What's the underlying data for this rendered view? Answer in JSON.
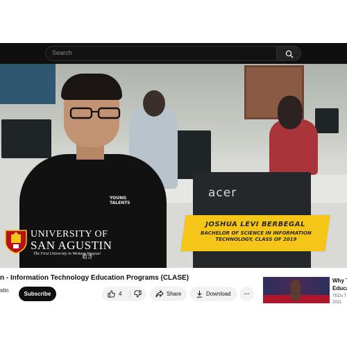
{
  "header": {
    "search_placeholder": "Search",
    "search_icon": "search-icon"
  },
  "video": {
    "logo": {
      "line1": "UNIVERSITY OF",
      "line2": "SAN AGUSTIN",
      "tagline": "The First University in Western Visayas!"
    },
    "lower_third": {
      "name": "JOSHUA LEVI BERBEGAL",
      "degree_line1": "BACHELOR OF SCIENCE IN INFORMATION",
      "degree_line2": "TECHNOLOGY, CLASS OF 2019"
    },
    "monitor_brand": "acer",
    "shirt_text": "YOUNG TALENTS",
    "shirt_kanji": "若き"
  },
  "info": {
    "title": "n - Information Technology Education Programs (CLASE)",
    "channel": "stin",
    "subscribe_label": "Subscribe"
  },
  "actions": {
    "like_count": "4",
    "share_label": "Share",
    "download_label": "Download",
    "more_label": "···"
  },
  "recommended": {
    "title_line1": "Why T",
    "title_line2": "Educa",
    "channel": "TEDx T",
    "meta": "2021"
  },
  "colors": {
    "header_bg": "#0f0f0f",
    "subscribe_bg": "#0f0f0f",
    "pill_bg": "#f2f2f2",
    "caption_yellow": "#f5c518"
  }
}
